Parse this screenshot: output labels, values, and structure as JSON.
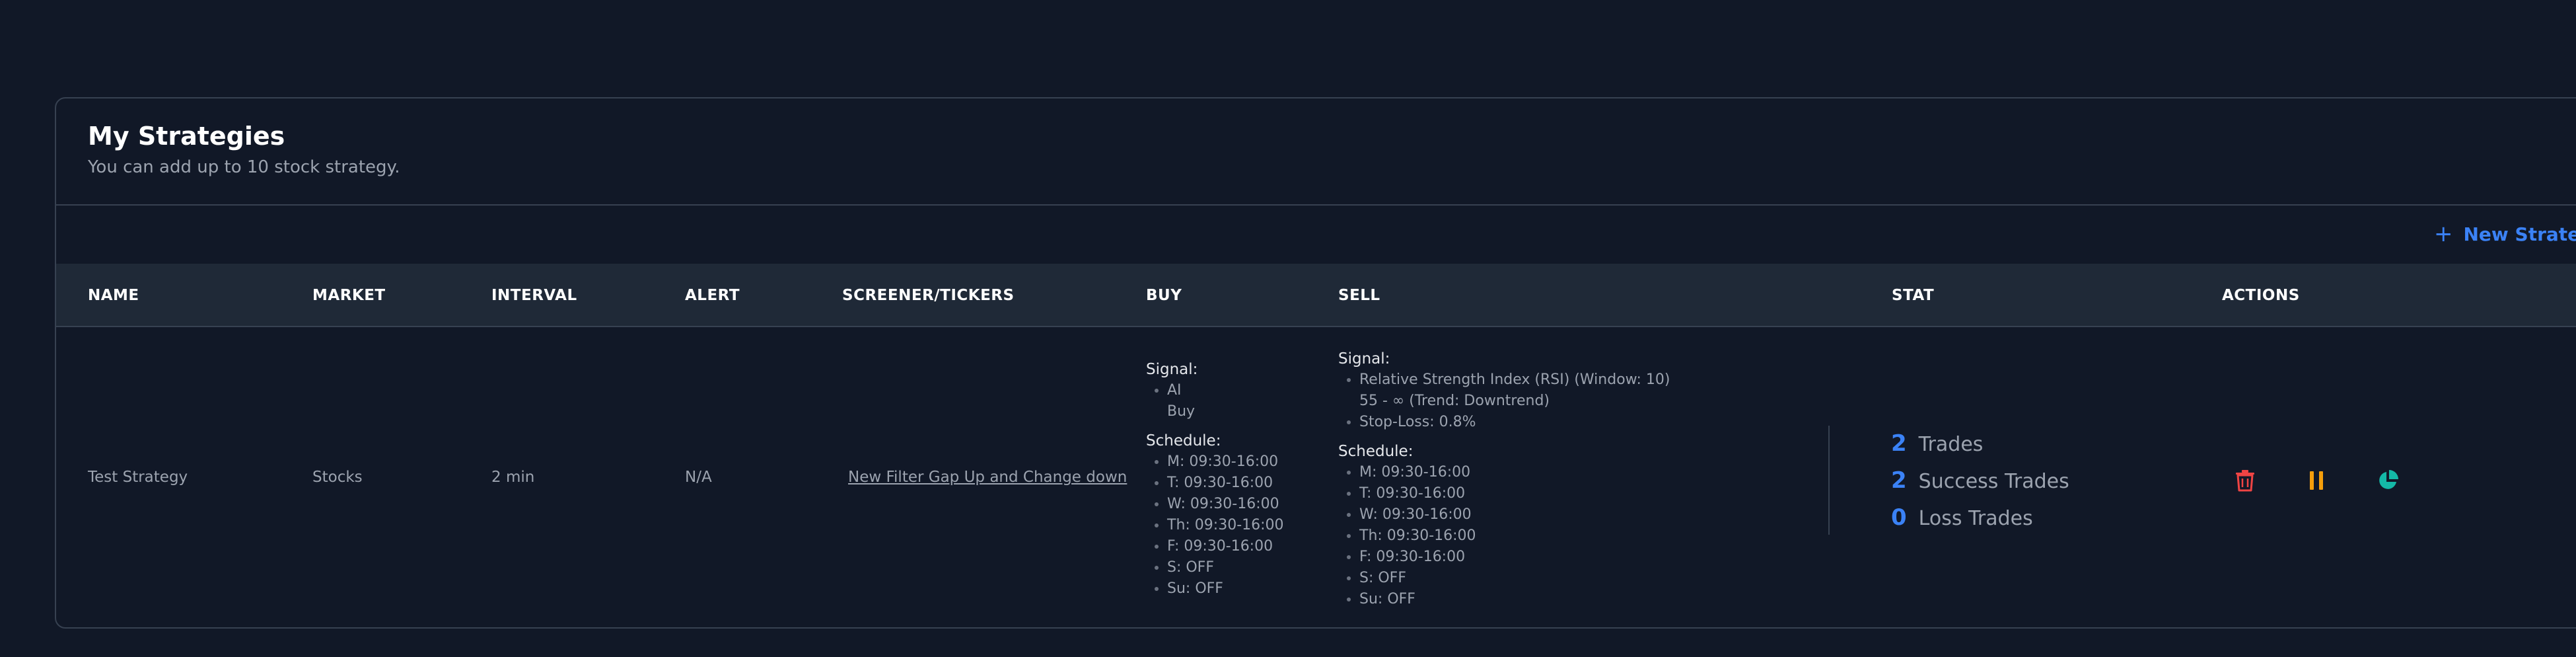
{
  "header": {
    "title": "My Strategies",
    "subtitle": "You can add up to 10 stock strategy."
  },
  "new_strategy": {
    "icon": "plus-icon",
    "label": "New Strategy"
  },
  "table": {
    "columns": [
      "NAME",
      "MARKET",
      "INTERVAL",
      "ALERT",
      "SCREENER/TICKERS",
      "BUY",
      "SELL",
      "STAT",
      "ACTIONS"
    ],
    "row": {
      "name": "Test Strategy",
      "market": "Stocks",
      "interval": "2 min",
      "alert": "N/A",
      "screener": "New Filter Gap Up and Change down",
      "buy": {
        "signal_label": "Signal:",
        "signals": [
          "AI",
          "Buy"
        ],
        "schedule_label": "Schedule:",
        "schedule": [
          "M: 09:30-16:00",
          "T: 09:30-16:00",
          "W: 09:30-16:00",
          "Th: 09:30-16:00",
          "F: 09:30-16:00",
          "S: OFF",
          "Su: OFF"
        ]
      },
      "sell": {
        "signal_label": "Signal:",
        "signals": [
          "Relative Strength Index (RSI) (Window: 10)",
          "55 - ∞ (Trend: Downtrend)",
          "Stop-Loss: 0.8%"
        ],
        "schedule_label": "Schedule:",
        "schedule": [
          "M: 09:30-16:00",
          "T: 09:30-16:00",
          "W: 09:30-16:00",
          "Th: 09:30-16:00",
          "F: 09:30-16:00",
          "S: OFF",
          "Su: OFF"
        ]
      },
      "stat": {
        "trades": {
          "value": "2",
          "label": "Trades"
        },
        "success": {
          "value": "2",
          "label": "Success Trades"
        },
        "loss": {
          "value": "0",
          "label": "Loss Trades"
        }
      },
      "actions": {
        "delete": {
          "icon": "trash-icon",
          "color": "#ef4444"
        },
        "pause": {
          "icon": "pause-icon",
          "color": "#f59e0b"
        },
        "stats": {
          "icon": "pie-chart-icon",
          "color": "#14b8a6"
        }
      }
    }
  },
  "colors": {
    "background": "#111827",
    "table_header": "#1f2937",
    "border": "#374151",
    "accent": "#3b82f6",
    "muted_text": "#9ca3af"
  }
}
